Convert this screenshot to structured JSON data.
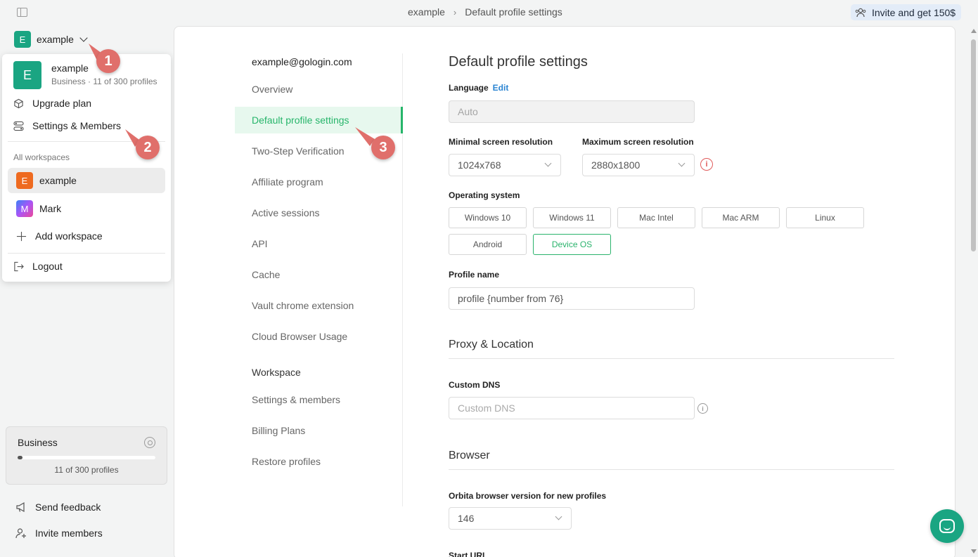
{
  "topbar": {
    "breadcrumb": [
      "example",
      "Default profile settings"
    ],
    "invite_label": "Invite and get 150$"
  },
  "workspace_switcher": {
    "initial": "E",
    "name": "example"
  },
  "dropdown": {
    "current": {
      "initial": "E",
      "name": "example",
      "subtitle": "Business · 11 of 300 profiles"
    },
    "upgrade_label": "Upgrade plan",
    "settings_label": "Settings & Members",
    "all_workspaces_caption": "All workspaces",
    "workspaces": [
      {
        "initial": "E",
        "name": "example"
      },
      {
        "initial": "M",
        "name": "Mark"
      }
    ],
    "add_workspace_label": "Add workspace",
    "logout_label": "Logout"
  },
  "plan_card": {
    "title": "Business",
    "progress": 0.037,
    "count_label": "11 of 300 profiles"
  },
  "sidebar_bottom": {
    "feedback_label": "Send feedback",
    "invite_members_label": "Invite members"
  },
  "callouts": [
    "1",
    "2",
    "3"
  ],
  "settings_nav": {
    "email": "example@gologin.com",
    "items": [
      "Overview",
      "Default profile settings",
      "Two-Step Verification",
      "Affiliate program",
      "Active sessions",
      "API",
      "Cache",
      "Vault chrome extension",
      "Cloud Browser Usage"
    ],
    "workspace_section": "Workspace",
    "workspace_items": [
      "Settings & members",
      "Billing Plans",
      "Restore profiles"
    ]
  },
  "content": {
    "title": "Default profile settings",
    "language_label": "Language",
    "language_edit": "Edit",
    "language_value": "Auto",
    "min_res_label": "Minimal screen resolution",
    "min_res_value": "1024x768",
    "max_res_label": "Maximum screen resolution",
    "max_res_value": "2880x1800",
    "os_label": "Operating system",
    "os_options": [
      "Windows 10",
      "Windows 11",
      "Mac Intel",
      "Mac ARM",
      "Linux",
      "Android",
      "Device OS"
    ],
    "os_selected": "Device OS",
    "profile_name_label": "Profile name",
    "profile_name_value": "profile {number from 76}",
    "proxy_heading": "Proxy & Location",
    "dns_label": "Custom DNS",
    "dns_placeholder": "Custom DNS",
    "browser_heading": "Browser",
    "orbita_label": "Orbita browser version for new profiles",
    "orbita_value": "146",
    "start_url_label": "Start URL"
  },
  "colors": {
    "accent_green": "#26b56a",
    "brand_green": "#1aa582",
    "callout_red": "#e06f6b",
    "link_blue": "#2a84d2"
  }
}
